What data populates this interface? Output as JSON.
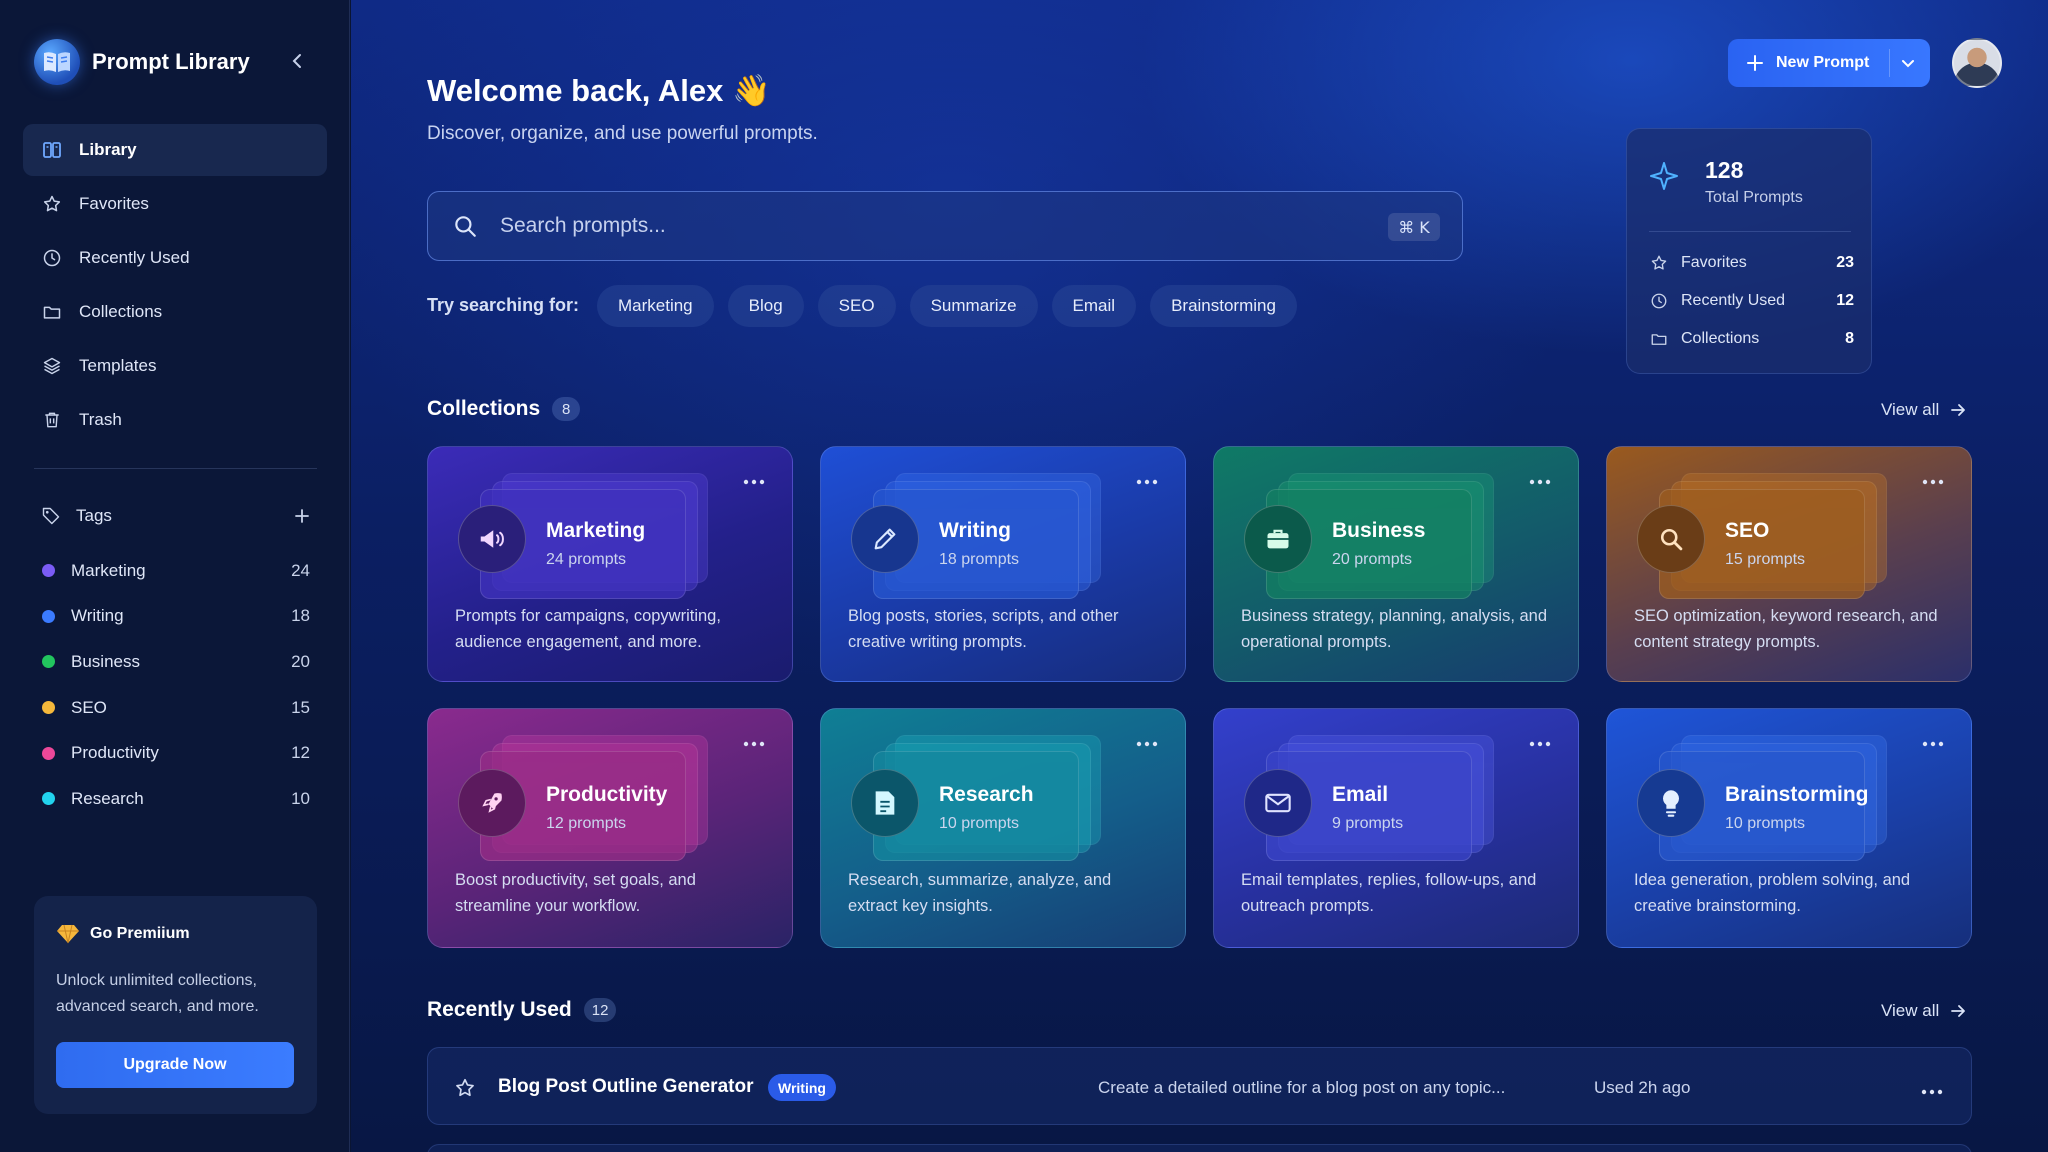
{
  "sidebar": {
    "brand": "Prompt Library",
    "nav": [
      {
        "label": "Library",
        "icon": "library-icon",
        "active": true
      },
      {
        "label": "Favorites",
        "icon": "star-icon"
      },
      {
        "label": "Recently Used",
        "icon": "clock-icon"
      },
      {
        "label": "Collections",
        "icon": "folder-icon"
      },
      {
        "label": "Templates",
        "icon": "layers-icon"
      },
      {
        "label": "Trash",
        "icon": "trash-icon"
      }
    ],
    "tags_label": "Tags",
    "tags": [
      {
        "label": "Marketing",
        "count": "24",
        "color": "#7b5cf5"
      },
      {
        "label": "Writing",
        "count": "18",
        "color": "#3b7bff"
      },
      {
        "label": "Business",
        "count": "20",
        "color": "#22c55e"
      },
      {
        "label": "SEO",
        "count": "15",
        "color": "#f5b83b"
      },
      {
        "label": "Productivity",
        "count": "12",
        "color": "#ec4899"
      },
      {
        "label": "Research",
        "count": "10",
        "color": "#22d3ee"
      }
    ],
    "premium": {
      "title": "Go Premiium",
      "text": "Unlock unlimited collections, advanced search, and more.",
      "button": "Upgrade Now"
    }
  },
  "header": {
    "welcome": "Welcome back, Alex 👋",
    "subtitle": "Discover, organize, and use powerful prompts.",
    "new_prompt": "New Prompt"
  },
  "stats": {
    "total": "128",
    "total_label": "Total Prompts",
    "rows": [
      {
        "label": "Favorites",
        "value": "23",
        "icon": "star-icon"
      },
      {
        "label": "Recently Used",
        "value": "12",
        "icon": "clock-icon"
      },
      {
        "label": "Collections",
        "value": "8",
        "icon": "folder-icon"
      }
    ]
  },
  "search": {
    "placeholder": "Search prompts...",
    "shortcut": "⌘ K",
    "try_label": "Try searching for:",
    "suggestions": [
      "Marketing",
      "Blog",
      "SEO",
      "Summarize",
      "Email",
      "Brainstorming"
    ]
  },
  "collections": {
    "title": "Collections",
    "count": "8",
    "view_all": "View all",
    "items": [
      {
        "name": "Marketing",
        "count": "24 prompts",
        "desc": "Prompts for campaigns, copywriting, audience engagement, and more.",
        "icon": "megaphone-icon",
        "color": "#7b5cf5"
      },
      {
        "name": "Writing",
        "count": "18 prompts",
        "desc": "Blog posts, stories, scripts, and other creative writing prompts.",
        "icon": "pencil-icon",
        "color": "#3b7bff"
      },
      {
        "name": "Business",
        "count": "20 prompts",
        "desc": "Business strategy, planning, analysis, and operational prompts.",
        "icon": "briefcase-icon",
        "color": "#22c55e"
      },
      {
        "name": "SEO",
        "count": "15 prompts",
        "desc": "SEO optimization, keyword research, and content strategy prompts.",
        "icon": "search-icon",
        "color": "#f59e0b"
      },
      {
        "name": "Productivity",
        "count": "12 prompts",
        "desc": "Boost productivity, set goals, and streamline your workflow.",
        "icon": "rocket-icon",
        "color": "#ec4899"
      },
      {
        "name": "Research",
        "count": "10 prompts",
        "desc": "Research, summarize, analyze, and extract key insights.",
        "icon": "document-icon",
        "color": "#14b8c4"
      },
      {
        "name": "Email",
        "count": "9 prompts",
        "desc": "Email templates, replies, follow-ups, and outreach prompts.",
        "icon": "mail-icon",
        "color": "#4f5ff0"
      },
      {
        "name": "Brainstorming",
        "count": "10 prompts",
        "desc": "Idea generation, problem solving, and creative brainstorming.",
        "icon": "lightbulb-icon",
        "color": "#2563eb"
      }
    ]
  },
  "recent": {
    "title": "Recently Used",
    "count": "12",
    "view_all": "View all",
    "items": [
      {
        "title": "Blog Post Outline Generator",
        "tag": "Writing",
        "desc": "Create a detailed outline for a blog post on any topic...",
        "time": "Used 2h ago"
      }
    ]
  }
}
